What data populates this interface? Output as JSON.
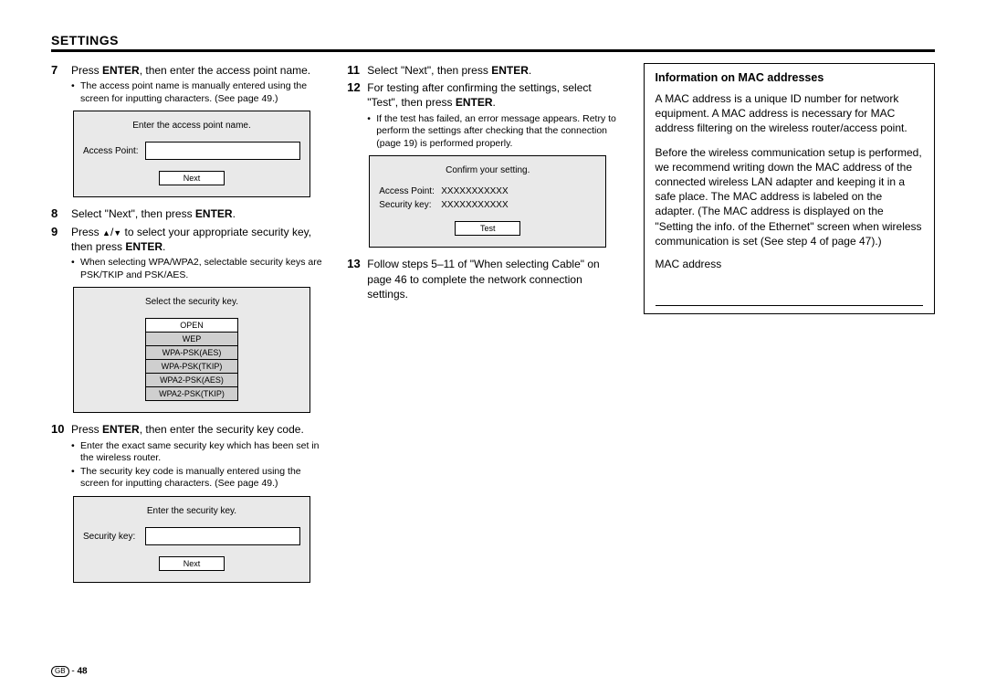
{
  "header": "SETTINGS",
  "col1": {
    "step7": {
      "num": "7",
      "pre": "Press ",
      "enter": "ENTER",
      "post": ", then enter the access point name."
    },
    "step7_bullets": [
      "The access point name is manually entered using the screen for inputting characters. (See page 49.)"
    ],
    "screen7": {
      "title": "Enter the access point name.",
      "label": "Access Point:",
      "btn": "Next"
    },
    "step8": {
      "num": "8",
      "pre": "Select \"Next\", then press ",
      "enter": "ENTER",
      "post": "."
    },
    "step9": {
      "num": "9",
      "pre": "Press ",
      "mid": " to select your appropriate security key, then press ",
      "enter": "ENTER",
      "post": "."
    },
    "step9_bullets": [
      "When selecting WPA/WPA2, selectable security keys are PSK/TKIP and PSK/AES."
    ],
    "screen9": {
      "title": "Select the security key.",
      "options": [
        "OPEN",
        "WEP",
        "WPA-PSK(AES)",
        "WPA-PSK(TKIP)",
        "WPA2-PSK(AES)",
        "WPA2-PSK(TKIP)"
      ]
    },
    "step10": {
      "num": "10",
      "pre": "Press ",
      "enter": "ENTER",
      "post": ", then enter the security key code."
    },
    "step10_bullets": [
      "Enter the exact same security key which has been set in the wireless router.",
      "The security key code is manually entered using the screen for inputting characters. (See page 49.)"
    ],
    "screen10": {
      "title": "Enter the security key.",
      "label": "Security key:",
      "btn": "Next"
    }
  },
  "col2": {
    "step11": {
      "num": "11",
      "pre": "Select \"Next\", then press ",
      "enter": "ENTER",
      "post": "."
    },
    "step12": {
      "num": "12",
      "text_a": "For testing after confirming the settings, select \"Test\", then press ",
      "enter": "ENTER",
      "text_b": "."
    },
    "step12_bullets": [
      "If the test has failed, an error message appears. Retry to perform the settings after checking that the connection (page 19) is performed properly."
    ],
    "screen12": {
      "title": "Confirm your setting.",
      "ap_label": "Access Point:",
      "ap_value": "XXXXXXXXXXX",
      "sk_label": "Security key:",
      "sk_value": "XXXXXXXXXXX",
      "btn": "Test"
    },
    "step13": {
      "num": "13",
      "text": "Follow steps 5–11 of \"When selecting Cable\" on page 46 to complete the network connection settings."
    }
  },
  "info": {
    "title": "Information on MAC addresses",
    "p1": "A MAC address is a unique ID number for network equipment. A MAC address is necessary for MAC address filtering on the wireless router/access point.",
    "p2": "Before the wireless communication setup is performed, we recommend writing down the MAC address of the connected wireless LAN adapter and keeping it in a safe place. The MAC address is labeled on the adapter. (The MAC address is displayed on the \"Setting the info. of the Ethernet\" screen when wireless communication is set (See step 4 of page 47).)",
    "mac_label": "MAC address"
  },
  "footer": {
    "region": "GB",
    "sep": " - ",
    "page": "48"
  }
}
